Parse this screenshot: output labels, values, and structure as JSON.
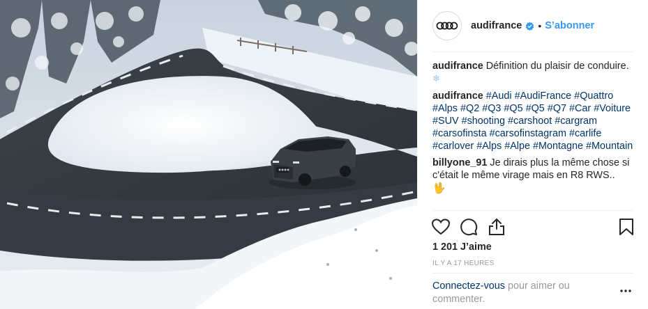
{
  "post": {
    "author": "audifrance",
    "header_separator": "•",
    "follow_label": "S’abonner",
    "photo_alt": "Audi Q3 on a snowy mountain hairpin road"
  },
  "comments": [
    {
      "user": "audifrance",
      "text": "Définition du plaisir de conduire.",
      "emoji": "❄"
    },
    {
      "user": "audifrance",
      "hashtags": [
        "#Audi",
        "#AudiFrance",
        "#Quattro",
        "#Alps",
        "#Q2",
        "#Q3",
        "#Q5",
        "#Q5",
        "#Q7",
        "#Car",
        "#Voiture",
        "#SUV",
        "#shooting",
        "#carshoot",
        "#cargram",
        "#carsofinsta",
        "#carsofinstagram",
        "#carlife",
        "#carlover",
        "#Alps",
        "#Alpe",
        "#Montagne",
        "#Mountain"
      ]
    },
    {
      "user": "billyone_91",
      "text": "Je dirais plus la même chose si c'était le même virage mais en R8 RWS..",
      "emoji": "🖖"
    }
  ],
  "actions": {
    "like_icon": "heart-icon",
    "comment_icon": "comment-icon",
    "share_icon": "share-icon",
    "save_icon": "bookmark-icon"
  },
  "likes": "1 201 J’aime",
  "timestamp": "IL Y A 17 HEURES",
  "login": {
    "link": "Connectez-vous",
    "text": " pour aimer ou commenter."
  },
  "colors": {
    "link_blue": "#3897f0",
    "hashtag_blue": "#003569",
    "text": "#262626",
    "muted": "#999999",
    "divider": "#efefef"
  }
}
